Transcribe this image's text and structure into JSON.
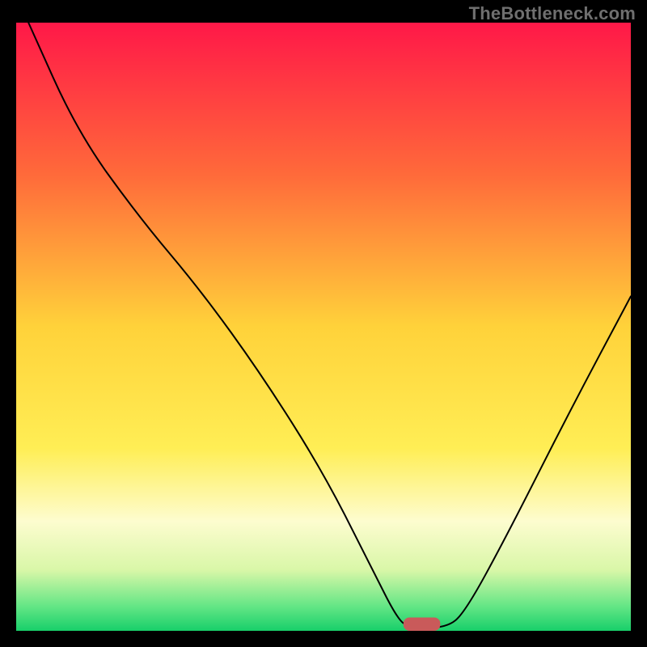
{
  "watermark": "TheBottleneck.com",
  "chart_data": {
    "type": "line",
    "title": "",
    "xlabel": "",
    "ylabel": "",
    "xlim": [
      0,
      100
    ],
    "ylim": [
      0,
      100
    ],
    "background_gradient_stops": [
      {
        "offset": 0,
        "color": "#ff1848"
      },
      {
        "offset": 25,
        "color": "#ff6a3a"
      },
      {
        "offset": 50,
        "color": "#ffd23a"
      },
      {
        "offset": 70,
        "color": "#ffee55"
      },
      {
        "offset": 82,
        "color": "#fdfccf"
      },
      {
        "offset": 90,
        "color": "#d9f7a8"
      },
      {
        "offset": 96,
        "color": "#63e685"
      },
      {
        "offset": 100,
        "color": "#18cf6a"
      }
    ],
    "curve_points": [
      {
        "x": 2,
        "y": 100
      },
      {
        "x": 10,
        "y": 82
      },
      {
        "x": 20,
        "y": 68
      },
      {
        "x": 30,
        "y": 56
      },
      {
        "x": 40,
        "y": 42
      },
      {
        "x": 50,
        "y": 26
      },
      {
        "x": 58,
        "y": 10
      },
      {
        "x": 62,
        "y": 2
      },
      {
        "x": 64,
        "y": 0.5
      },
      {
        "x": 70,
        "y": 0.5
      },
      {
        "x": 73,
        "y": 3
      },
      {
        "x": 80,
        "y": 16
      },
      {
        "x": 90,
        "y": 36
      },
      {
        "x": 100,
        "y": 55
      }
    ],
    "optimal_marker": {
      "x": 66,
      "y": 0,
      "width": 6,
      "height": 2.2,
      "fill": "#c95a5a"
    }
  }
}
